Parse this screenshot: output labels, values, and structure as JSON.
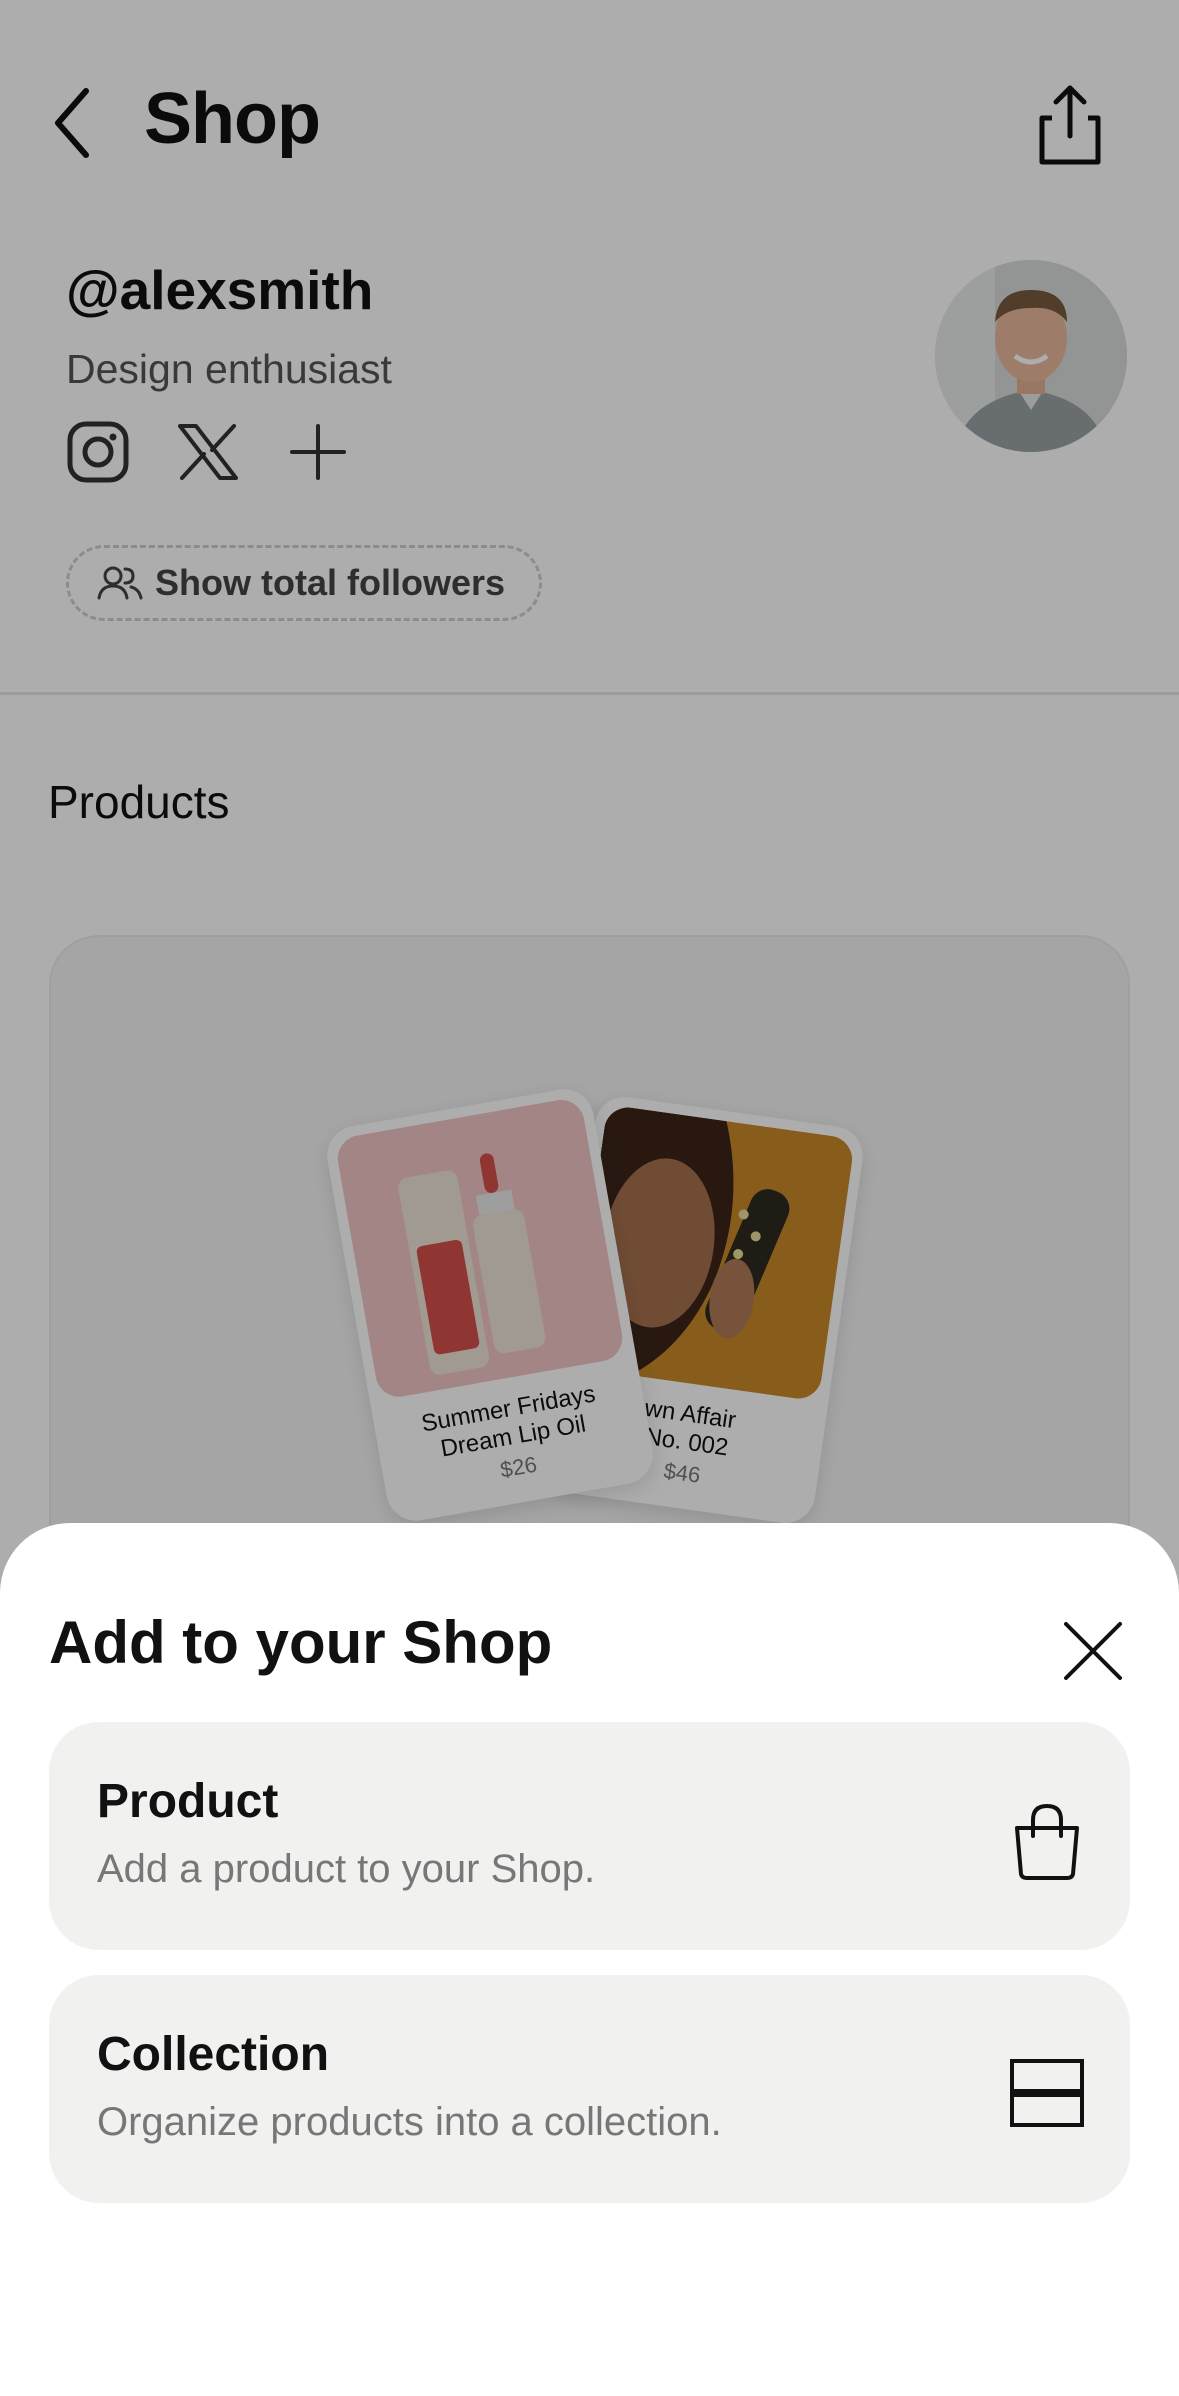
{
  "header": {
    "title": "Shop",
    "back_icon": "chevron-left-icon",
    "share_icon": "share-icon"
  },
  "profile": {
    "handle": "@alexsmith",
    "bio": "Design enthusiast",
    "socials": [
      "instagram-icon",
      "x-icon",
      "plus-icon"
    ],
    "followers_button": "Show total followers"
  },
  "products": {
    "section_title": "Products",
    "items": [
      {
        "name_line1": "Summer Fridays",
        "name_line2": "Dream Lip Oil",
        "price": "$26"
      },
      {
        "name_line1": "wn Affair",
        "name_line2": "No. 002",
        "price": "$46"
      }
    ]
  },
  "sheet": {
    "title": "Add to your Shop",
    "close_icon": "close-icon",
    "options": [
      {
        "title": "Product",
        "description": "Add a product to your Shop.",
        "icon": "shopping-bag-icon"
      },
      {
        "title": "Collection",
        "description": "Organize products into a collection.",
        "icon": "collection-icon"
      }
    ]
  },
  "colors": {
    "overlay": "#000000",
    "sheet_bg": "#ffffff",
    "option_bg": "#f1f1f0",
    "text_primary": "#111111",
    "text_secondary": "#777777"
  }
}
